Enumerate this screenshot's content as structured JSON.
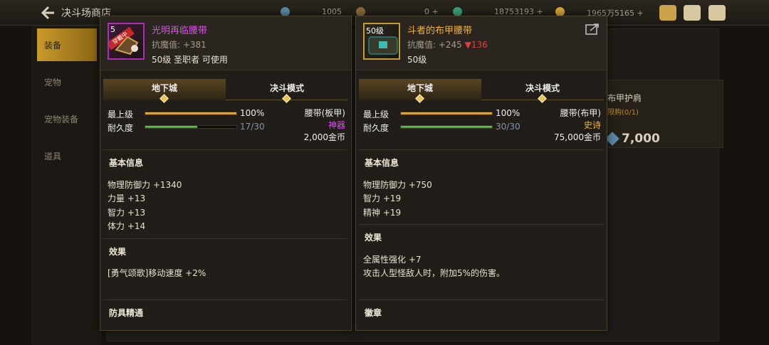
{
  "header": {
    "title": "决斗场商店",
    "resources": [
      {
        "value": "1005",
        "color": "#5a8aa8"
      },
      {
        "value": "0 +",
        "color": "#8a6a3a"
      },
      {
        "value": "18753193 +",
        "color": "#3aa07a"
      },
      {
        "value": "1965万5165 +",
        "color": "#d8a23a"
      }
    ]
  },
  "sidebar": {
    "items": [
      {
        "label": "装备"
      },
      {
        "label": "宠物"
      },
      {
        "label": "宠物装备"
      },
      {
        "label": "道具"
      }
    ]
  },
  "bg_card": {
    "title": "布甲护肩",
    "sub": "限购(0/1)",
    "price": "7,000"
  },
  "left_item": {
    "icon_level": "5",
    "icon_badge": "穿戴中",
    "name": "光明再临腰带",
    "resist_label": "抗魔值: +381",
    "requirement": "50级 圣职者 可使用",
    "tabs": [
      "地下城",
      "决斗模式"
    ],
    "level_label": "最上级",
    "level_value": "100%",
    "level_fill": 1.0,
    "durability_label": "耐久度",
    "durability_value": "17/30",
    "durability_fill": 0.567,
    "type": "腰带(板甲)",
    "rarity": "神器",
    "price": "2,000金币",
    "basic_title": "基本信息",
    "basic": [
      "物理防御力 +1340",
      "力量 +13",
      "智力 +13",
      "体力 +14"
    ],
    "effect_title": "效果",
    "effects": [
      "[勇气颂歌]移动速度 +2%"
    ],
    "mastery_title": "防具精通"
  },
  "right_item": {
    "icon_level": "50级",
    "name": "斗者的布甲腰带",
    "resist_label": "抗魔值: +245",
    "resist_diff": "▼136",
    "requirement": "50级",
    "tabs": [
      "地下城",
      "决斗模式"
    ],
    "level_label": "最上级",
    "level_value": "100%",
    "level_fill": 1.0,
    "durability_label": "耐久度",
    "durability_value": "30/30",
    "durability_fill": 1.0,
    "type": "腰带(布甲)",
    "rarity": "史诗",
    "price": "75,000金币",
    "basic_title": "基本信息",
    "basic": [
      "物理防御力 +750",
      "智力 +19",
      "精神 +19"
    ],
    "effect_title": "效果",
    "effects": [
      "全属性强化 +7",
      "攻击人型怪敌人时，附加5%的伤害。"
    ],
    "badge_title": "徽章"
  }
}
